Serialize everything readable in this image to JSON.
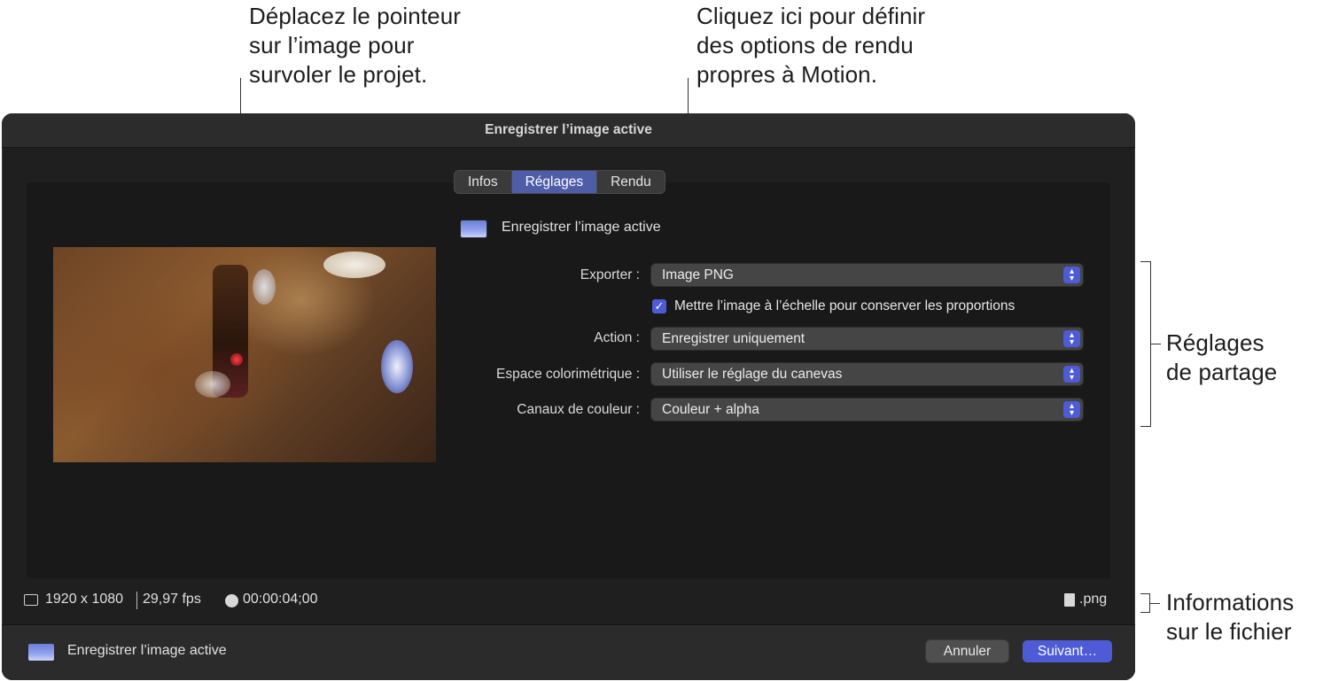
{
  "callouts": {
    "preview": "Déplacez le pointeur\nsur l’image pour\nsurvoler le projet.",
    "render": "Cliquez ici pour définir\ndes options de rendu\npropres à Motion.",
    "settings": "Réglages\nde partage",
    "file": "Informations\nsur le fichier"
  },
  "window": {
    "title": "Enregistrer l’image active",
    "tabs": [
      {
        "label": "Infos",
        "active": false
      },
      {
        "label": "Réglages",
        "active": true
      },
      {
        "label": "Rendu",
        "active": false
      }
    ],
    "header_label": "Enregistrer l’image active",
    "header_icon": "image-thumbnail-icon",
    "fields": {
      "export": {
        "label": "Exporter :",
        "value": "Image PNG"
      },
      "scale": {
        "label": "Mettre l’image à l’échelle pour conserver les proportions",
        "checked": true
      },
      "action": {
        "label": "Action :",
        "value": "Enregistrer uniquement"
      },
      "colorspace": {
        "label": "Espace colorimétrique :",
        "value": "Utiliser le réglage du canevas"
      },
      "channels": {
        "label": "Canaux de couleur :",
        "value": "Couleur + alpha"
      }
    },
    "info": {
      "resolution": "1920 x 1080",
      "fps": "29,97 fps",
      "duration": "00:00:04;00",
      "extension": ".png"
    },
    "footer": {
      "label": "Enregistrer l’image active",
      "cancel": "Annuler",
      "next": "Suivant…"
    }
  },
  "colors": {
    "accent": "#4d5bd6",
    "window_bg": "#1f1f1f",
    "panel_bg": "#191919"
  }
}
